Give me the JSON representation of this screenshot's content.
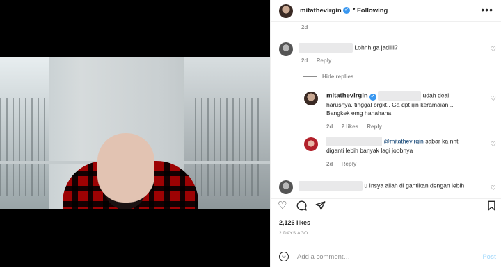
{
  "post": {
    "username": "mitathevirgin",
    "verified_mark": "✔",
    "separator": "•",
    "following_label": "Following",
    "more_icon": "more-horizontal-icon"
  },
  "comments": [
    {
      "time": "2d"
    },
    {
      "text": "Lohhh ga jadiiii?",
      "time": "2d",
      "reply_label": "Reply"
    },
    {
      "hide_replies_label": "Hide replies"
    },
    {
      "username": "mitathevirgin",
      "text_line1": "udah deal",
      "text_line2": "harusnya, tinggal brgkt.. Ga dpt ijin keramaian ..",
      "text_line3": "Bangkek emg hahahaha",
      "time": "2d",
      "likes": "2 likes",
      "reply_label": "Reply"
    },
    {
      "mention": "@mitathevirgin",
      "text_line1": " sabar ka nnti",
      "text_line2": "diganti lebih banyak lagi joobnya",
      "time": "2d",
      "reply_label": "Reply"
    },
    {
      "text": "u Insya allah di gantikan dengan lebih"
    }
  ],
  "footer": {
    "likes": "2,126 likes",
    "time_ago": "2 DAYS AGO",
    "add_comment_placeholder": "Add a comment…",
    "post_label": "Post"
  }
}
